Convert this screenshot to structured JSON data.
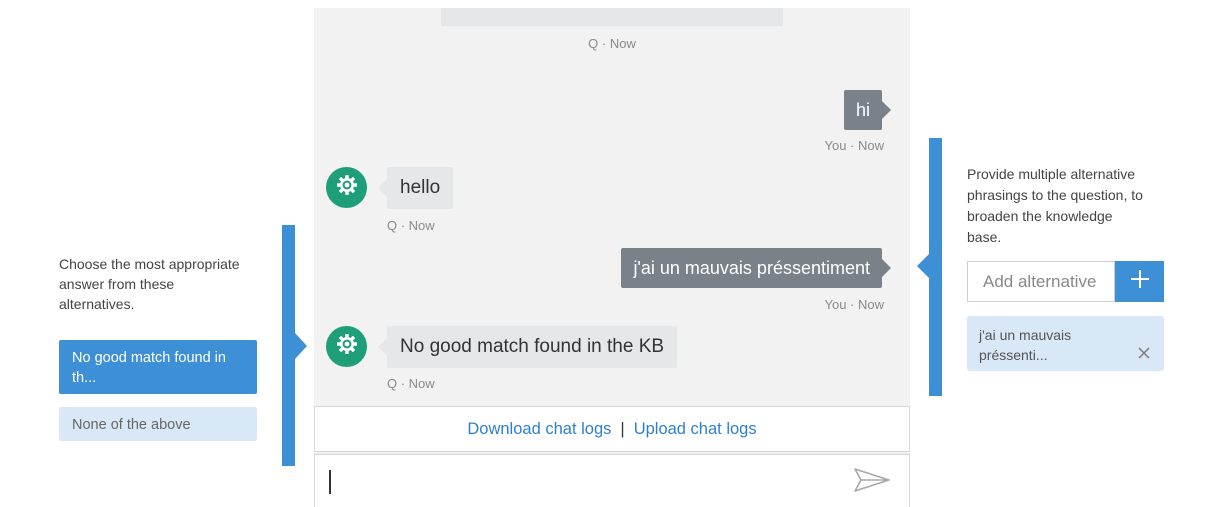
{
  "left_panel": {
    "description": "Choose the most appropriate answer from these alternatives.",
    "options": [
      {
        "label": "No good match found in th..."
      },
      {
        "label": "None of the above"
      }
    ]
  },
  "chat": {
    "top_meta": "Q · Now",
    "messages": [
      {
        "sender": "user",
        "text": "hi",
        "meta": "You · Now"
      },
      {
        "sender": "bot",
        "text": "hello",
        "meta": "Q · Now"
      },
      {
        "sender": "user",
        "text": "j'ai un mauvais préssentiment",
        "meta": "You · Now"
      },
      {
        "sender": "bot",
        "text": "No good match found in the KB",
        "meta": "Q · Now"
      }
    ],
    "links": {
      "download": "Download chat logs",
      "separator": "|",
      "upload": "Upload chat logs"
    },
    "input": {
      "value": ""
    }
  },
  "right_panel": {
    "description": "Provide multiple alternative phrasings to the question, to broaden the knowledge base.",
    "add_placeholder": "Add alternative",
    "chip_text": "j'ai un mauvais préssenti..."
  },
  "colors": {
    "accent": "#3d8fd6",
    "user_bubble": "#7b8188",
    "bot_avatar": "#1f9e7a",
    "link": "#2f7fd0"
  }
}
